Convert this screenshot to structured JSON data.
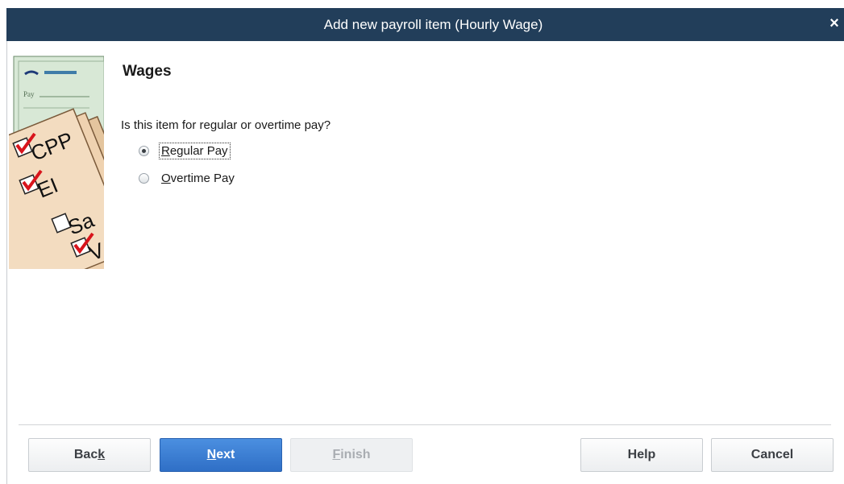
{
  "window": {
    "title": "Add new payroll item (Hourly Wage)",
    "close_glyph": "×"
  },
  "illustration": {
    "icon": "payroll-checklist-illustration",
    "items": [
      "CPP",
      "EI",
      "Sa",
      "V"
    ],
    "checked": [
      true,
      true,
      false,
      true
    ],
    "cheque_text": "Pay"
  },
  "content": {
    "section_title": "Wages",
    "question": "Is this item for regular or overtime pay?",
    "options": [
      {
        "label_ul": "R",
        "label_rest": "egular Pay",
        "selected": true
      },
      {
        "label_ul": "O",
        "label_rest": "vertime Pay",
        "selected": false
      }
    ]
  },
  "buttons": {
    "back_pre": "Bac",
    "back_ul": "k",
    "next_ul": "N",
    "next_rest": "ext",
    "finish_ul": "F",
    "finish_rest": "inish",
    "help": "Help",
    "cancel": "Cancel"
  },
  "colors": {
    "title_bar": "#223e5a",
    "primary_button": "#3a7bd5",
    "check_red": "#d8141c"
  }
}
